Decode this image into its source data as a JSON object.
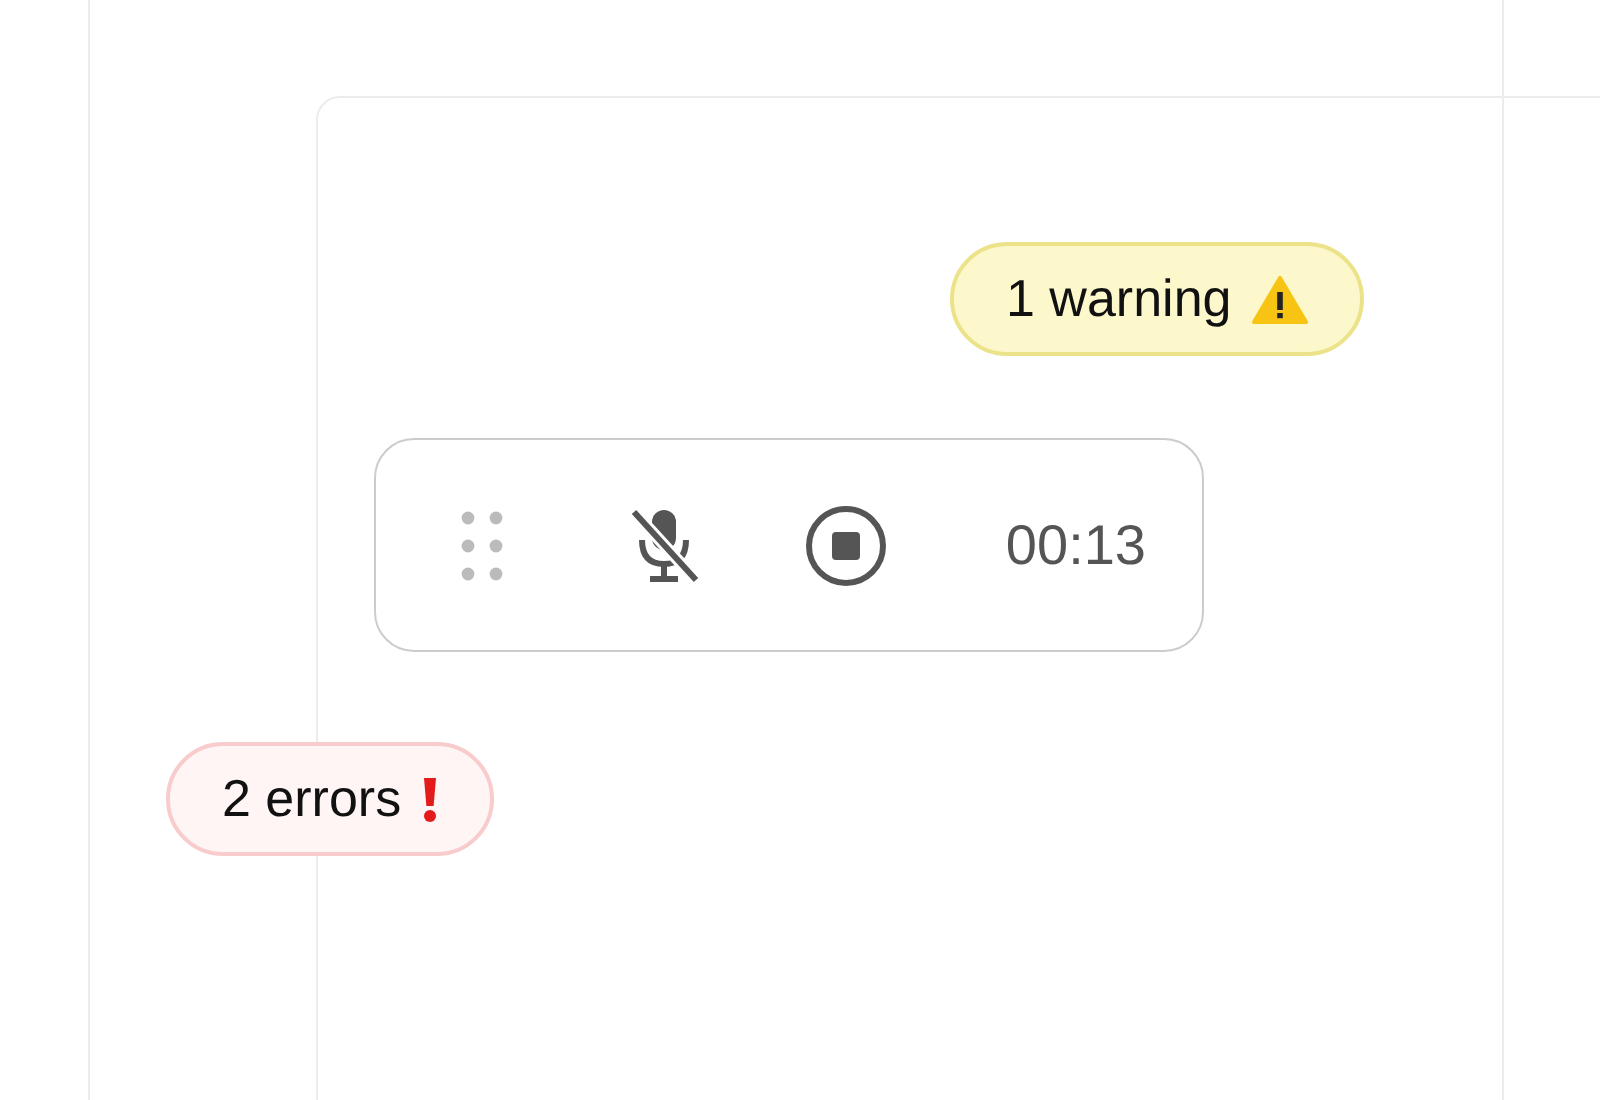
{
  "badges_top": [
    {
      "kind": "warning",
      "label": "1 warning"
    }
  ],
  "recorder": {
    "microphone_muted": true,
    "recording": true,
    "timer": "00:13"
  },
  "badges_bottom": [
    {
      "kind": "error",
      "label": "2 errors"
    }
  ]
}
